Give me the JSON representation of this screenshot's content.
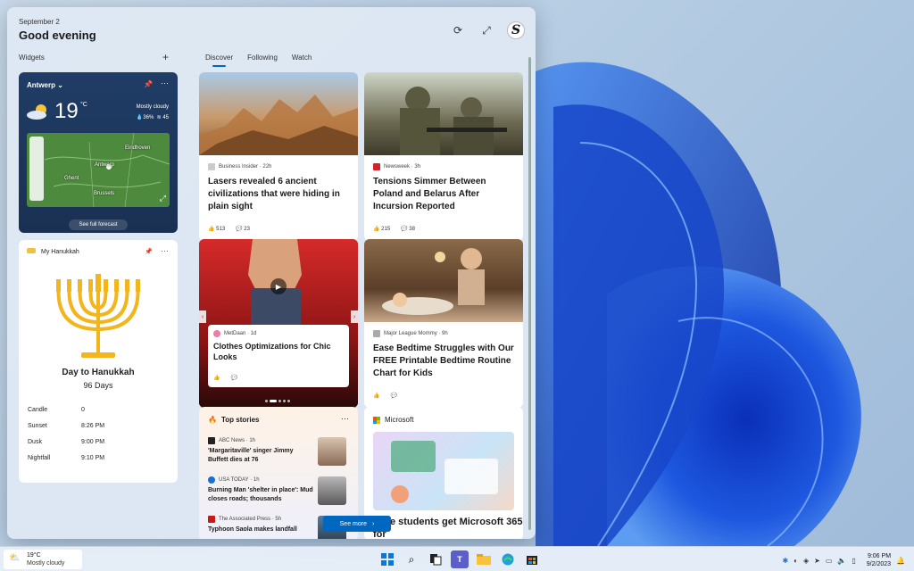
{
  "panel": {
    "date": "September 2",
    "greeting": "Good evening",
    "widgets_label": "Widgets",
    "avatar_letter": "S",
    "icons": [
      "refresh-icon",
      "expand-icon"
    ]
  },
  "tabs": [
    {
      "label": "Discover",
      "active": true
    },
    {
      "label": "Following",
      "active": false
    },
    {
      "label": "Watch",
      "active": false
    }
  ],
  "weather": {
    "city": "Antwerp",
    "temp": "19",
    "unit": "°C",
    "condition": "Mostly cloudy",
    "precip": "36%",
    "wind": "45",
    "map_labels": [
      "Eindhoven",
      "Antwerp",
      "Ghent",
      "Brussels"
    ],
    "forecast_button": "See full forecast"
  },
  "hanukkah": {
    "title": "My Hanukkah",
    "heading": "Day to Hanukkah",
    "days": "96 Days",
    "rows": [
      {
        "key": "Candle",
        "value": "0"
      },
      {
        "key": "Sunset",
        "value": "8:26 PM"
      },
      {
        "key": "Dusk",
        "value": "9:00 PM"
      },
      {
        "key": "Nightfall",
        "value": "9:10 PM"
      }
    ]
  },
  "cards": {
    "c1": {
      "source": "Business Insider · 22h",
      "title": "Lasers revealed 6 ancient civilizations that were hiding in plain sight",
      "likes": "513",
      "comments": "23"
    },
    "c2": {
      "source": "Newsweek · 3h",
      "title": "Tensions Simmer Between Poland and Belarus After Incursion Reported",
      "likes": "215",
      "comments": "38"
    },
    "c3": {
      "source": "MetDaan · 1d",
      "title": "Clothes Optimizations for Chic Looks"
    },
    "c4": {
      "source": "Major League Mommy · 9h",
      "title": "Ease Bedtime Struggles with Our FREE Printable Bedtime Routine Chart for Kids"
    },
    "top_stories": {
      "header": "Top stories",
      "items": [
        {
          "source": "ABC News · 1h",
          "text": "'Margaritaville' singer Jimmy Buffett dies at 76"
        },
        {
          "source": "USA TODAY · 1h",
          "text": "Burning Man 'shelter in place': Mud closes roads; thousands"
        },
        {
          "source": "The Associated Press · 5h",
          "text": "Typhoon Saola makes landfall"
        }
      ],
      "see_more": "See more"
    },
    "microsoft": {
      "header": "Microsoft",
      "title": "llege students get Microsoft 365 for"
    }
  },
  "taskbar": {
    "temp": "19°C",
    "condition": "Mostly cloudy",
    "time": "9:06 PM",
    "date": "9/2/2023",
    "apps": [
      "start-icon",
      "search-icon",
      "task-view-icon",
      "teams-icon",
      "file-explorer-icon",
      "edge-icon",
      "store-icon"
    ]
  },
  "colors": {
    "accent": "#0067c0",
    "weather_bg": "#203d66",
    "menorah": "#f2b51c"
  }
}
